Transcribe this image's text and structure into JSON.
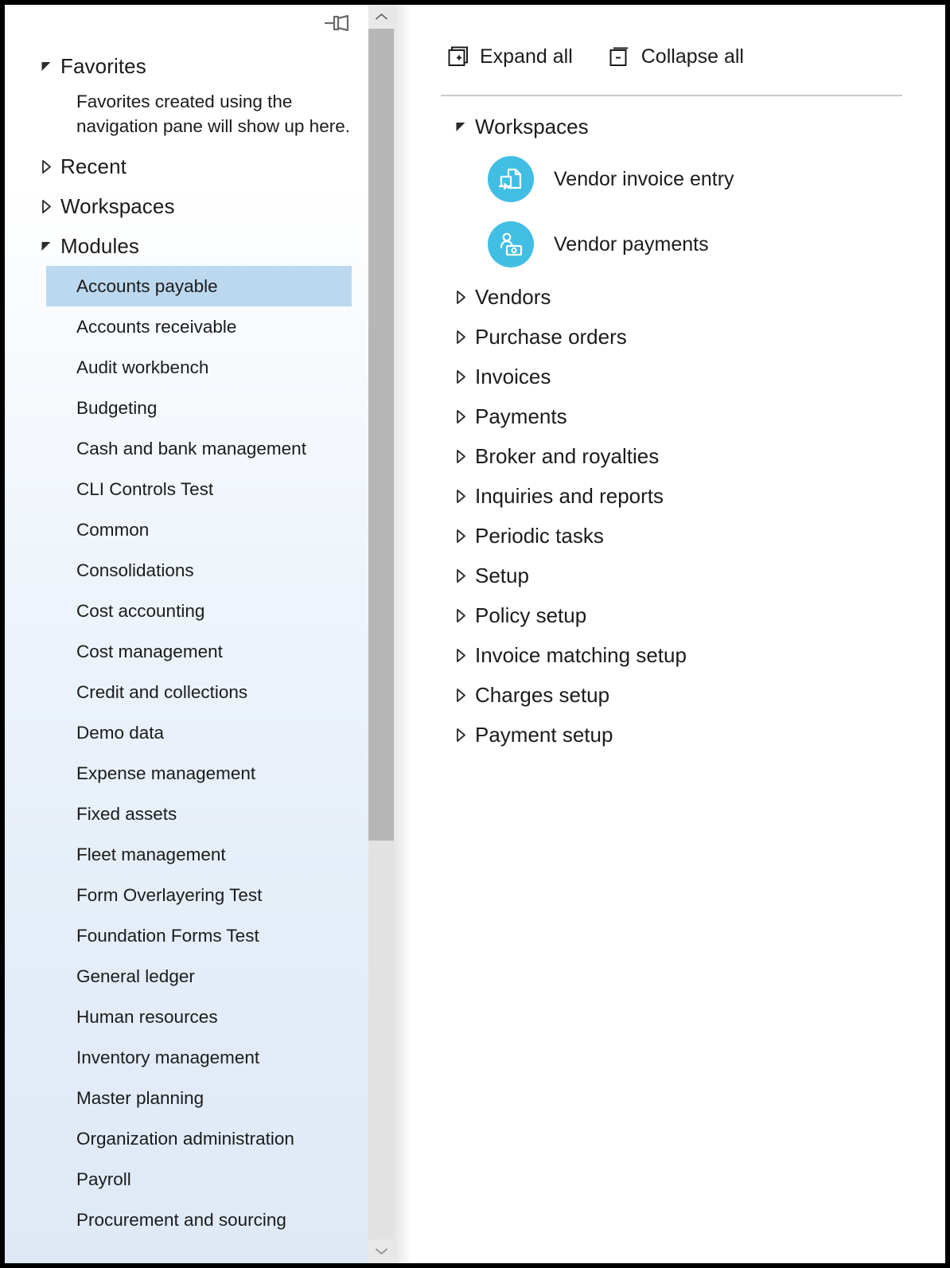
{
  "colors": {
    "accent_cyan": "#41bee4",
    "selection_blue": "#bcd8ef",
    "text": "#1b1b1b",
    "divider": "#c9c9c9",
    "scroll_thumb": "#b6b6b6",
    "scroll_track": "#e2e2e2"
  },
  "left_pane": {
    "pin_icon": "pin-icon",
    "sections": [
      {
        "label": "Favorites",
        "expanded": true,
        "note": "Favorites created using the navigation pane will show up here."
      },
      {
        "label": "Recent",
        "expanded": false
      },
      {
        "label": "Workspaces",
        "expanded": false
      },
      {
        "label": "Modules",
        "expanded": true
      }
    ],
    "modules": [
      {
        "label": "Accounts payable",
        "selected": true
      },
      {
        "label": "Accounts receivable",
        "selected": false
      },
      {
        "label": "Audit workbench",
        "selected": false
      },
      {
        "label": "Budgeting",
        "selected": false
      },
      {
        "label": "Cash and bank management",
        "selected": false
      },
      {
        "label": "CLI Controls Test",
        "selected": false
      },
      {
        "label": "Common",
        "selected": false
      },
      {
        "label": "Consolidations",
        "selected": false
      },
      {
        "label": "Cost accounting",
        "selected": false
      },
      {
        "label": "Cost management",
        "selected": false
      },
      {
        "label": "Credit and collections",
        "selected": false
      },
      {
        "label": "Demo data",
        "selected": false
      },
      {
        "label": "Expense management",
        "selected": false
      },
      {
        "label": "Fixed assets",
        "selected": false
      },
      {
        "label": "Fleet management",
        "selected": false
      },
      {
        "label": "Form Overlayering Test",
        "selected": false
      },
      {
        "label": "Foundation Forms Test",
        "selected": false
      },
      {
        "label": "General ledger",
        "selected": false
      },
      {
        "label": "Human resources",
        "selected": false
      },
      {
        "label": "Inventory management",
        "selected": false
      },
      {
        "label": "Master planning",
        "selected": false
      },
      {
        "label": "Organization administration",
        "selected": false
      },
      {
        "label": "Payroll",
        "selected": false
      },
      {
        "label": "Procurement and sourcing",
        "selected": false
      }
    ],
    "scrollbar": {
      "up_icon": "chevron-up-icon",
      "down_icon": "chevron-down-icon"
    }
  },
  "right_pane": {
    "toolbar": {
      "expand_all_label": "Expand all",
      "expand_all_icon": "box-plus-icon",
      "collapse_all_label": "Collapse all",
      "collapse_all_icon": "box-minus-icon"
    },
    "tree": [
      {
        "label": "Workspaces",
        "expanded": true,
        "children": [
          {
            "label": "Vendor invoice entry",
            "icon": "document-import-icon"
          },
          {
            "label": "Vendor payments",
            "icon": "person-money-icon"
          }
        ]
      },
      {
        "label": "Vendors",
        "expanded": false
      },
      {
        "label": "Purchase orders",
        "expanded": false
      },
      {
        "label": "Invoices",
        "expanded": false
      },
      {
        "label": "Payments",
        "expanded": false
      },
      {
        "label": "Broker and royalties",
        "expanded": false
      },
      {
        "label": "Inquiries and reports",
        "expanded": false
      },
      {
        "label": "Periodic tasks",
        "expanded": false
      },
      {
        "label": "Setup",
        "expanded": false
      },
      {
        "label": "Policy setup",
        "expanded": false
      },
      {
        "label": "Invoice matching setup",
        "expanded": false
      },
      {
        "label": "Charges setup",
        "expanded": false
      },
      {
        "label": "Payment setup",
        "expanded": false
      }
    ]
  }
}
